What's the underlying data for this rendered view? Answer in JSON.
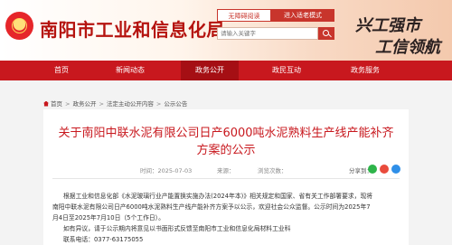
{
  "header": {
    "site_title": "南阳市工业和信息化局",
    "accessibility_label": "无障碍阅读",
    "mobile_label": "进入适老模式",
    "search_placeholder": "请输入关键字",
    "slogan_line1": "兴工强市",
    "slogan_line2": "工信领航",
    "brand_color": "#c8181e"
  },
  "nav": {
    "items": [
      "首页",
      "新闻动态",
      "政务公开",
      "政民互动",
      "政务服务"
    ],
    "active_index": 2
  },
  "breadcrumb": {
    "items": [
      "首页",
      "政务公开",
      "法定主动公开内容",
      "公示公告"
    ]
  },
  "article": {
    "title_line1": "关于南阳中联水泥有限公司日产6000吨水泥熟料生产线产能补齐",
    "title_line2": "方案的公示",
    "date": "时间：2025-07-03",
    "source": "来源：",
    "views": "浏览次数：",
    "share_label": "分享到：",
    "paragraphs": [
      "根据工业和信息化部《水泥玻璃行业产能置换实施办法(2024年本)》相关规定和国家、省有关工作部署要求，现将",
      "南阳中联水泥有限公司日产6000吨水泥熟料生产线产能补齐方案予以公示，欢迎社会公众监督。公示时间为2025年7",
      "月4日至2025年7月10日（5个工作日）。",
      "如有异议，请于公示期内将意见以书面形式反馈至南阳市工业和信息化局材料工业科",
      "联系电话：0377-63175055"
    ]
  }
}
